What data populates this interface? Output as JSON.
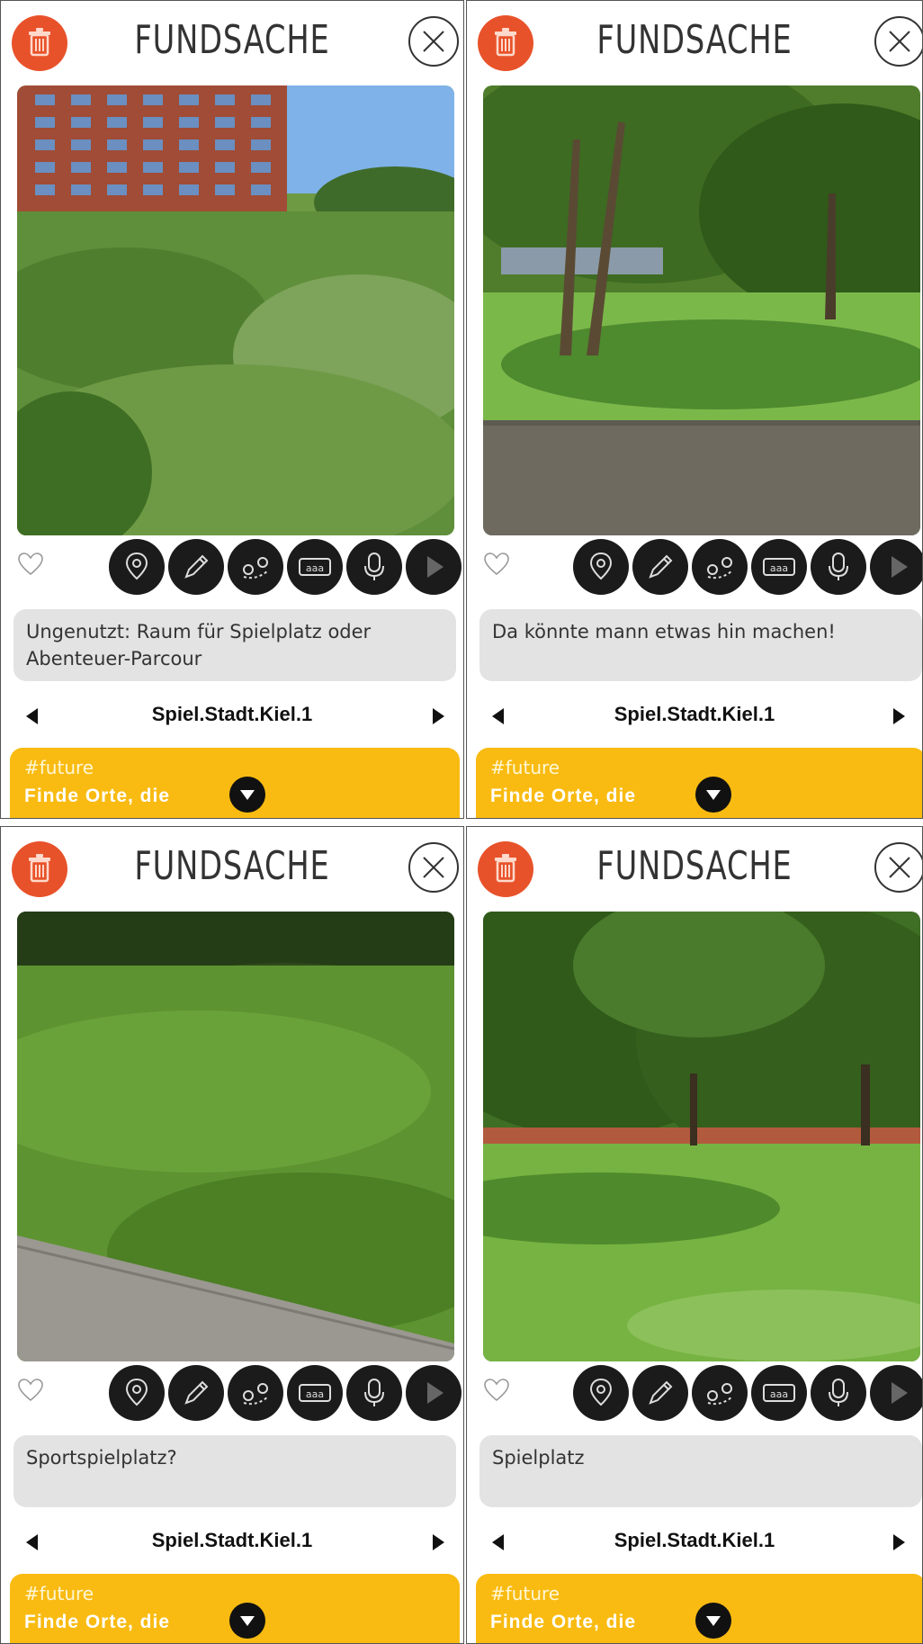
{
  "screens": [
    {
      "title": "FUNDSACHE",
      "description": "Ungenutzt: Raum für Spielplatz oder Abenteuer-Parcour",
      "project": "Spiel.Stadt.Kiel.1",
      "tag": "#future",
      "mission": "Finde Orte, die",
      "photo_scene": "building"
    },
    {
      "title": "FUNDSACHE",
      "description": "Da könnte mann etwas hin machen!",
      "project": "Spiel.Stadt.Kiel.1",
      "tag": "#future",
      "mission": "Finde Orte, die",
      "photo_scene": "park-path"
    },
    {
      "title": "FUNDSACHE",
      "description": "Sportspielplatz?",
      "project": "Spiel.Stadt.Kiel.1",
      "tag": "#future",
      "mission": "Finde Orte, die",
      "photo_scene": "meadow"
    },
    {
      "title": "FUNDSACHE",
      "description": "Spielplatz",
      "project": "Spiel.Stadt.Kiel.1",
      "tag": "#future",
      "mission": "Finde Orte, die",
      "photo_scene": "trees-lawn"
    }
  ],
  "icons": [
    "trash-icon",
    "close-icon",
    "heart-icon",
    "location-pin-icon",
    "pencil-icon",
    "route-icon",
    "text-icon",
    "microphone-icon",
    "play-icon",
    "arrow-left-icon",
    "arrow-right-icon",
    "chevron-down-icon"
  ],
  "colors": {
    "accent": "#e8522a",
    "banner": "#f9bb12",
    "button": "#1b1b1b",
    "description_bg": "#e3e3e3"
  }
}
